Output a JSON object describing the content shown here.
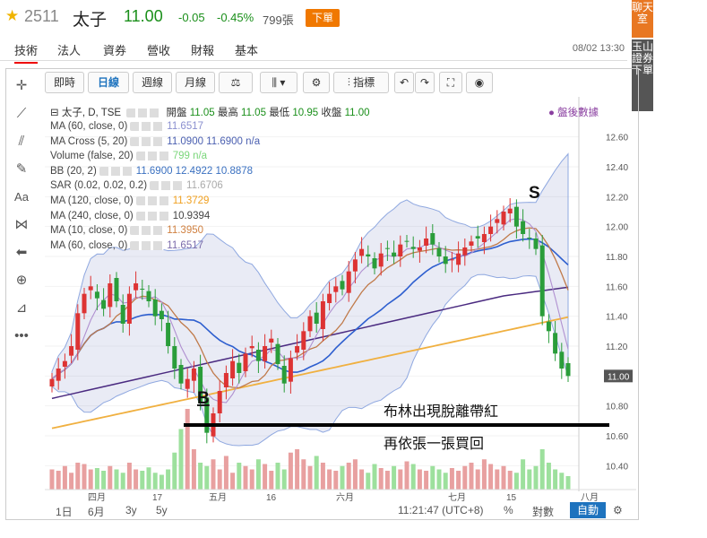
{
  "header": {
    "code": "2511",
    "name": "太子",
    "price": "11.00",
    "change": "-0.05",
    "change_pct": "-0.45%",
    "volume": "799張",
    "order_label": "下單"
  },
  "tabs": [
    {
      "label": "技術",
      "active": true
    },
    {
      "label": "法人"
    },
    {
      "label": "資券"
    },
    {
      "label": "營收"
    },
    {
      "label": "財報"
    },
    {
      "label": "基本"
    }
  ],
  "timestamp": "08/02 13:30",
  "side": {
    "chat": "聊天室",
    "broker": "玉山證券下單"
  },
  "toolbar": {
    "intraday": "即時",
    "daily": "日線",
    "weekly": "週線",
    "monthly": "月線",
    "indicators": "指標"
  },
  "legend": {
    "title": "太子, D, TSE",
    "open_label": "開盤",
    "open": "11.05",
    "high_label": "最高",
    "high": "11.05",
    "low_label": "最低",
    "low": "10.95",
    "close_label": "收盤",
    "close": "11.00",
    "indicator_link": "盤後數據",
    "rows": [
      {
        "label": "MA (60, close, 0)",
        "value": "11.6517",
        "color": "#8a8fcf"
      },
      {
        "label": "MA Cross (5, 20)",
        "value": "11.0900  11.6900  n/a",
        "color": "#4a5fb0"
      },
      {
        "label": "Volume (false, 20)",
        "value": "799  n/a",
        "color": "#7bd67b"
      },
      {
        "label": "BB (20, 2)",
        "value": "11.6900  12.4922  10.8878",
        "color": "#3a70c0"
      },
      {
        "label": "SAR (0.02, 0.02, 0.2)",
        "value": "11.6706",
        "color": "#aaaaaa"
      },
      {
        "label": "MA (120, close, 0)",
        "value": "11.3729",
        "color": "#f0a020"
      },
      {
        "label": "MA (240, close, 0)",
        "value": "10.9394",
        "color": "#444444"
      },
      {
        "label": "MA (10, close, 0)",
        "value": "11.3950",
        "color": "#d08040"
      },
      {
        "label": "MA (60, close, 0)",
        "value": "11.6517",
        "color": "#7a6aaa"
      }
    ]
  },
  "chart_data": {
    "type": "candlestick",
    "y_ticks": [
      "12.60",
      "12.40",
      "12.20",
      "12.00",
      "11.80",
      "11.60",
      "11.40",
      "11.20",
      "11.00",
      "10.80",
      "10.60",
      "10.40"
    ],
    "ylim": [
      10.3,
      12.7
    ],
    "x_ticks": [
      "四月",
      "17",
      "五月",
      "16",
      "六月",
      "七月",
      "15",
      "八月"
    ],
    "last_price_label": "11.00",
    "annotations": {
      "buy": "B",
      "sell": "S",
      "line1": "布林出現脫離帶紅",
      "line2": "再依張一張買回"
    },
    "closes": [
      10.98,
      11.05,
      11.1,
      11.2,
      11.42,
      11.55,
      11.6,
      11.52,
      11.45,
      11.62,
      11.5,
      11.35,
      11.55,
      11.62,
      11.58,
      11.5,
      11.4,
      11.38,
      11.2,
      11.05,
      10.95,
      10.98,
      11.05,
      10.82,
      10.62,
      10.75,
      10.9,
      11.02,
      11.1,
      11.02,
      11.15,
      11.2,
      11.1,
      11.2,
      11.25,
      11.08,
      10.95,
      11.12,
      11.2,
      11.3,
      11.4,
      11.35,
      11.5,
      11.55,
      11.6,
      11.58,
      11.7,
      11.78,
      11.85,
      11.8,
      11.72,
      11.82,
      11.85,
      11.8,
      11.88,
      11.9,
      11.85,
      11.86,
      11.92,
      11.88,
      11.8,
      11.75,
      11.78,
      11.82,
      11.86,
      11.9,
      11.92,
      11.95,
      12.0,
      12.05,
      12.1,
      12.12,
      12.0,
      11.95,
      11.92,
      11.85,
      11.4,
      11.3,
      11.15,
      11.05,
      11.0
    ],
    "volumes": [
      30,
      28,
      35,
      25,
      40,
      38,
      30,
      32,
      28,
      35,
      30,
      25,
      40,
      30,
      28,
      33,
      25,
      22,
      30,
      55,
      90,
      120,
      60,
      40,
      35,
      45,
      30,
      50,
      25,
      40,
      35,
      30,
      45,
      38,
      28,
      40,
      30,
      55,
      60,
      45,
      35,
      50,
      40,
      30,
      28,
      35,
      40,
      45,
      30,
      25,
      38,
      32,
      28,
      35,
      30,
      42,
      38,
      30,
      28,
      35,
      30,
      25,
      32,
      28,
      35,
      40,
      30,
      45,
      38,
      30,
      35,
      28,
      25,
      45,
      30,
      35,
      60,
      40,
      30,
      25,
      20
    ]
  }
}
